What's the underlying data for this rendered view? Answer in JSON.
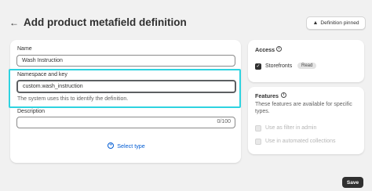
{
  "header": {
    "title": "Add product metafield definition",
    "pin_button": "Definition pinned"
  },
  "form": {
    "name_label": "Name",
    "name_value": "Wash Instruction",
    "namespace_label": "Namespace and key",
    "namespace_value": "custom.wash_instruction",
    "namespace_help": "The system uses this to identify the definition.",
    "description_label": "Description",
    "description_count": "0/100",
    "select_type": "Select type"
  },
  "access": {
    "title": "Access",
    "storefronts_label": "Storefronts",
    "storefronts_checked": true,
    "storefronts_badge": "Read"
  },
  "features": {
    "title": "Features",
    "description": "These features are available for specific types.",
    "filter_label": "Use as filter in admin",
    "automated_label": "Use in automated collections"
  },
  "footer": {
    "save_label": "Save"
  },
  "colors": {
    "highlight": "#2ed3e0",
    "link": "#005bd3",
    "primary_button": "#303030"
  }
}
